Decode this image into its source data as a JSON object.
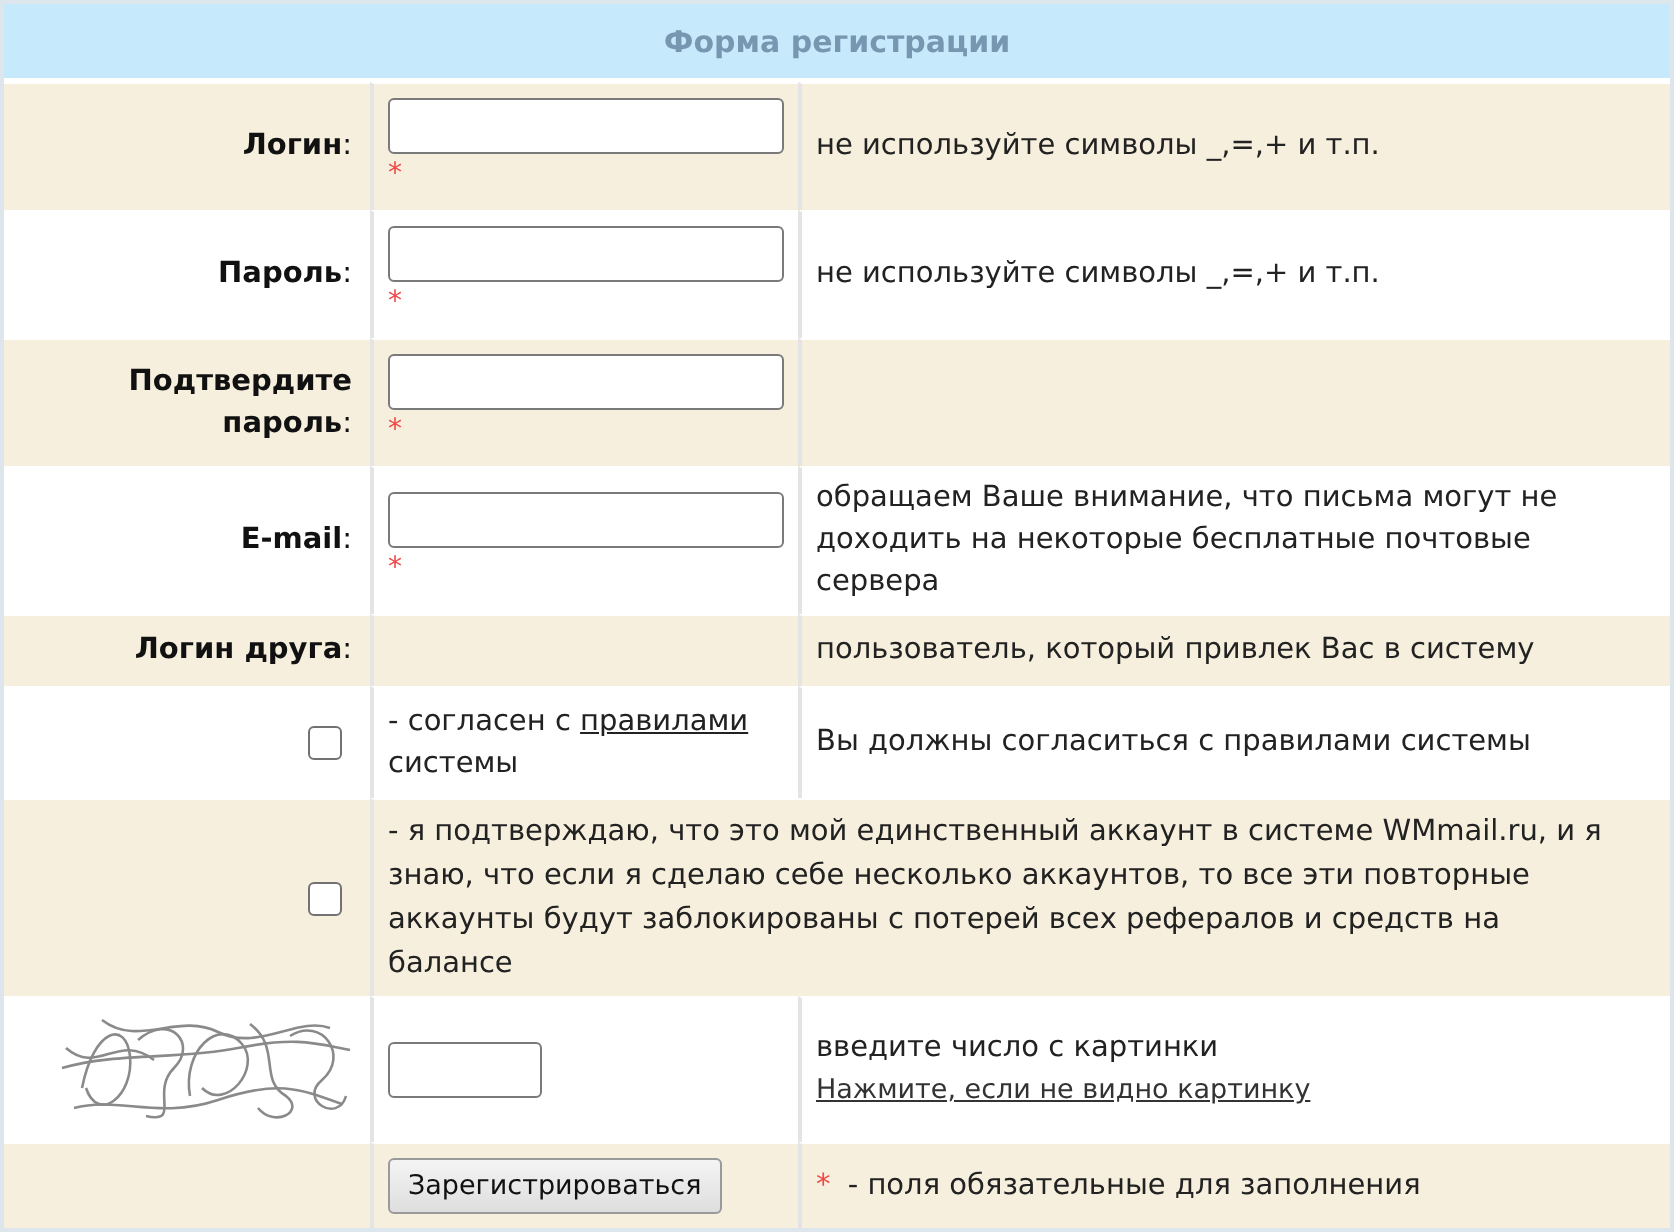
{
  "form": {
    "title": "Форма регистрации",
    "rows": [
      {
        "kind": "field",
        "label": "**Логин**:",
        "required_mark": "*",
        "hint": "не используйте символы _,=,+ и т.п."
      },
      {
        "kind": "field",
        "label": "**Пароль**:",
        "required_mark": "*",
        "hint": "не используйте символы _,=,+ и т.п."
      },
      {
        "kind": "field",
        "label": "**Подтвердите пароль**:",
        "required_mark": "*"
      },
      {
        "kind": "field",
        "label": "**E-mail**:",
        "required_mark": "*",
        "hint": "обращаем Ваше внимание, что письма могут не доходить на некоторые бесплатные почтовые сервера"
      },
      {
        "kind": "info",
        "label": "**Логин друга**:",
        "hint": "пользователь, который привлек Вас в систему"
      },
      {
        "kind": "agree",
        "checked": false,
        "text_before": "- согласен с",
        "link": "правилами",
        "text_after": "системы",
        "hint": "Вы должны согласиться с правилами системы"
      },
      {
        "kind": "confirm",
        "checked": false,
        "text": "- я подтверждаю, что это мой единственный аккаунт в системе WMmail.ru, и я знаю, что если я сделаю себе несколько аккаунтов, то все эти повторные аккаунты будут заблокированы с потерей всех рефералов и средств на балансе"
      },
      {
        "kind": "captcha",
        "hint": "введите число с картинки",
        "link": "Нажмите, если не видно картинку"
      },
      {
        "kind": "submit",
        "button": "Зарегистрироваться",
        "note_mark": "*",
        "note": "- поля обязательные для заполнения"
      }
    ]
  }
}
